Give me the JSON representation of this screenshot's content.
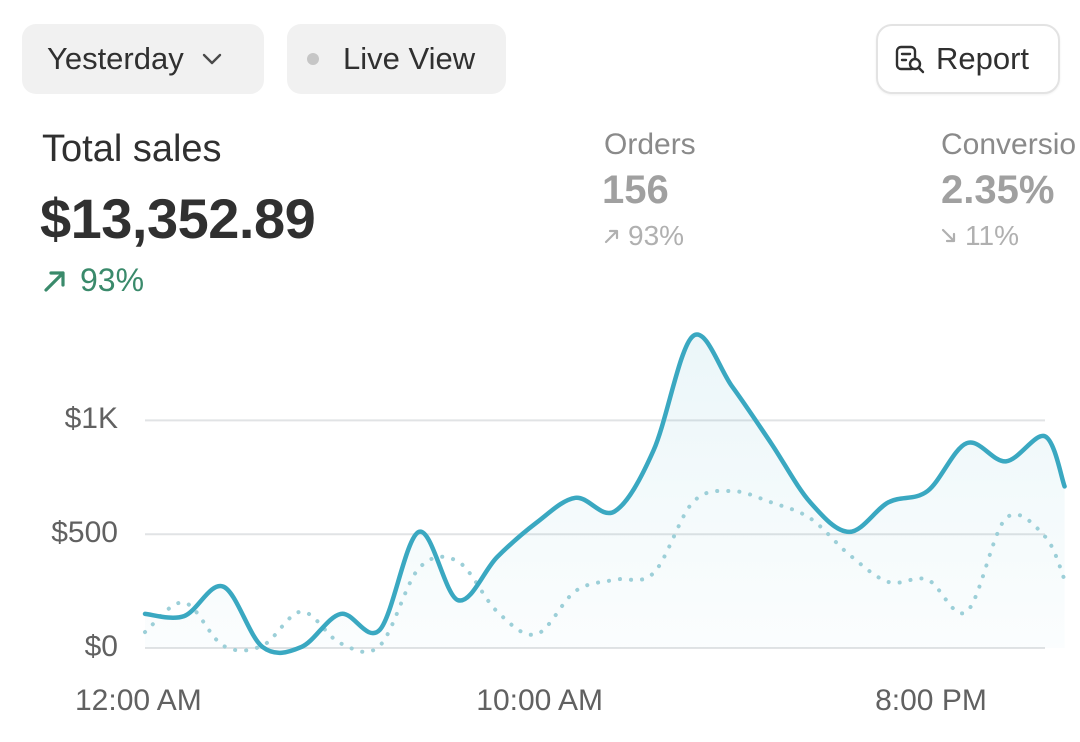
{
  "filters": {
    "date_label": "Yesterday",
    "live_label": "Live View"
  },
  "actions": {
    "report_label": "Report"
  },
  "metrics": {
    "total_sales": {
      "title": "Total sales",
      "value": "$13,352.89",
      "change": "93%",
      "direction": "up"
    },
    "orders": {
      "title": "Orders",
      "value": "156",
      "change": "93%",
      "direction": "up"
    },
    "conversion": {
      "title": "Conversio",
      "value": "2.35%",
      "change": "11%",
      "direction": "down"
    }
  },
  "colors": {
    "primary_line": "#3aa8c1",
    "comparison_line": "#9ccfd8",
    "up": "#3a8a6b",
    "grid": "#e1e3e5"
  },
  "icons": [
    "chevron-down-icon",
    "status-dot-icon",
    "report-search-icon",
    "arrow-up-right-icon",
    "arrow-down-right-icon"
  ],
  "chart_data": {
    "type": "line",
    "ylabels": [
      "$1K",
      "$500",
      "$0"
    ],
    "yticks": [
      1000,
      500,
      0
    ],
    "xlabels": [
      "12:00 AM",
      "10:00 AM",
      "8:00 PM"
    ],
    "xticks": [
      0,
      10,
      20
    ],
    "ylim": [
      0,
      1450
    ],
    "xlim": [
      0,
      23
    ],
    "grid": true,
    "series": [
      {
        "style": "solid",
        "points": [
          [
            0,
            150
          ],
          [
            1,
            140
          ],
          [
            2,
            270
          ],
          [
            3,
            5
          ],
          [
            4,
            5
          ],
          [
            5,
            150
          ],
          [
            6,
            80
          ],
          [
            7,
            510
          ],
          [
            8,
            210
          ],
          [
            9,
            400
          ],
          [
            10,
            550
          ],
          [
            11,
            660
          ],
          [
            12,
            600
          ],
          [
            13,
            870
          ],
          [
            14,
            1370
          ],
          [
            15,
            1150
          ],
          [
            16,
            900
          ],
          [
            17,
            640
          ],
          [
            18,
            510
          ],
          [
            19,
            640
          ],
          [
            20,
            690
          ],
          [
            21,
            900
          ],
          [
            22,
            820
          ],
          [
            23,
            930
          ],
          [
            23.5,
            710
          ]
        ]
      },
      {
        "style": "dotted",
        "points": [
          [
            0,
            70
          ],
          [
            1,
            200
          ],
          [
            2,
            10
          ],
          [
            3,
            10
          ],
          [
            4,
            160
          ],
          [
            5,
            20
          ],
          [
            6,
            10
          ],
          [
            7,
            350
          ],
          [
            8,
            380
          ],
          [
            9,
            160
          ],
          [
            10,
            60
          ],
          [
            11,
            250
          ],
          [
            12,
            300
          ],
          [
            13,
            330
          ],
          [
            14,
            640
          ],
          [
            15,
            690
          ],
          [
            16,
            640
          ],
          [
            17,
            570
          ],
          [
            18,
            410
          ],
          [
            19,
            290
          ],
          [
            20,
            300
          ],
          [
            21,
            160
          ],
          [
            22,
            570
          ],
          [
            23,
            490
          ],
          [
            23.5,
            300
          ]
        ]
      }
    ]
  }
}
